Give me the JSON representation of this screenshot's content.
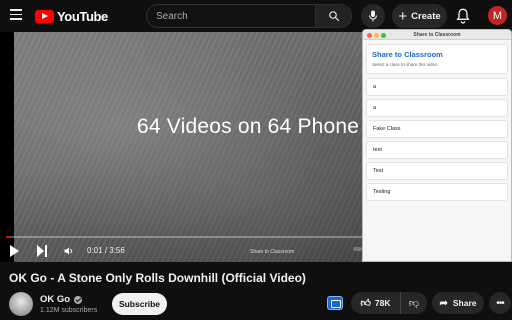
{
  "header": {
    "logo_text": "YouTube",
    "search_placeholder": "Search",
    "create_label": "Create",
    "avatar_initial": "M",
    "icons": [
      "menu-icon",
      "youtube-logo-icon",
      "search-icon",
      "mic-icon",
      "plus-icon",
      "bell-icon"
    ]
  },
  "player": {
    "caption": "64 Videos on 64 Phone",
    "time": "0:01 / 3:56",
    "progress": 0.01,
    "share_caption": "Share to Classroom"
  },
  "video": {
    "title": "OK Go - A Stone Only Rolls Downhill (Official Video)",
    "channel_name": "OK Go",
    "subscribers": "1.12M subscribers",
    "subscribe_label": "Subscribe",
    "like_count": "78K",
    "share_label": "Share"
  },
  "popup": {
    "window_title": "Share to Classroom",
    "heading": "Share to Classroom",
    "subheading": "Select a class to share this video",
    "classes": [
      "a",
      "a",
      "Fake Class",
      "test",
      "Test",
      "Testing"
    ]
  },
  "colors": {
    "brand_red": "#ff0000",
    "classroom_blue": "#1967d2",
    "background": "#0f0f0f"
  }
}
